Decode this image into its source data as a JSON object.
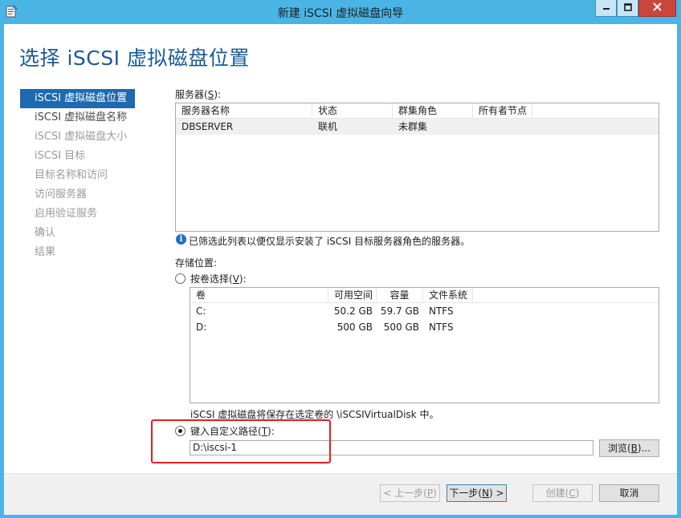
{
  "window": {
    "title": "新建 iSCSI 虚拟磁盘向导",
    "accent_color": "#4ab5e5",
    "icons": {
      "app": "wizard-app-icon",
      "minimize": "minimize-icon",
      "maximize": "maximize-icon",
      "close": "close-icon"
    }
  },
  "page": {
    "title": "选择 iSCSI 虚拟磁盘位置"
  },
  "nav": {
    "items": [
      {
        "label": "iSCSI 虚拟磁盘位置",
        "state": "active"
      },
      {
        "label": "iSCSI 虚拟磁盘名称",
        "state": "enabled"
      },
      {
        "label": "iSCSI 虚拟磁盘大小",
        "state": "disabled"
      },
      {
        "label": "iSCSI 目标",
        "state": "disabled"
      },
      {
        "label": "目标名称和访问",
        "state": "disabled"
      },
      {
        "label": "访问服务器",
        "state": "disabled"
      },
      {
        "label": "启用验证服务",
        "state": "disabled"
      },
      {
        "label": "确认",
        "state": "disabled"
      },
      {
        "label": "结果",
        "state": "disabled"
      }
    ]
  },
  "server": {
    "label_prefix": "服务器(",
    "label_key": "S",
    "label_suffix": "):",
    "columns": [
      "服务器名称",
      "状态",
      "群集角色",
      "所有者节点"
    ],
    "rows": [
      [
        "DBSERVER",
        "联机",
        "未群集",
        ""
      ]
    ],
    "info_text": "已筛选此列表以便仅显示安装了 iSCSI 目标服务器角色的服务器。"
  },
  "storage": {
    "label": "存储位置:",
    "by_volume": {
      "label_prefix": "按卷选择(",
      "label_key": "V",
      "label_suffix": "):",
      "selected": false
    },
    "volume_columns": [
      "卷",
      "可用空间",
      "容量",
      "文件系统"
    ],
    "volumes": [
      [
        "C:",
        "50.2 GB",
        "59.7 GB",
        "NTFS"
      ],
      [
        "D:",
        "500 GB",
        "500 GB",
        "NTFS"
      ]
    ],
    "note": "iSCSI 虚拟磁盘将保存在选定卷的 \\iSCSIVirtualDisk 中。",
    "custom_path": {
      "label_prefix": "键入自定义路径(",
      "label_key": "T",
      "label_suffix": "):",
      "selected": true,
      "value": "D:\\iscsi-1"
    },
    "browse_label_prefix": "浏览(",
    "browse_label_key": "B",
    "browse_label_suffix": ")..."
  },
  "footer": {
    "back_prefix": "< 上一步(",
    "back_key": "P",
    "back_suffix": ")",
    "next_prefix": "下一步(",
    "next_key": "N",
    "next_suffix": ") >",
    "create_prefix": "创建(",
    "create_key": "C",
    "create_suffix": ")",
    "cancel": "取消"
  }
}
